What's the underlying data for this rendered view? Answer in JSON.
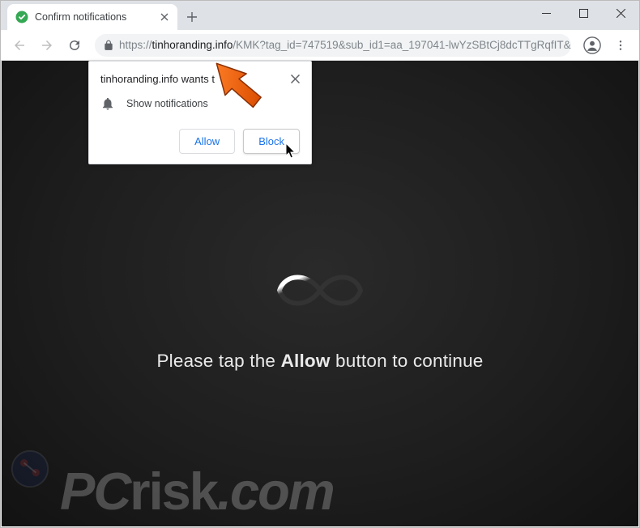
{
  "tab": {
    "title": "Confirm notifications"
  },
  "address": {
    "protocol": "https://",
    "host": "tinhoranding.info",
    "path": "/KMK?tag_id=747519&sub_id1=aa_197041-lwYzSBtCj8dcTTgRqfIT&..."
  },
  "dialog": {
    "title": "tinhoranding.info wants t",
    "body": "Show notifications",
    "allow": "Allow",
    "block": "Block"
  },
  "page": {
    "prefix": "Please tap the ",
    "bold": "Allow",
    "suffix": " button to continue"
  },
  "watermark": {
    "text_pc": "PC",
    "text_risk": "risk",
    "text_com": ".com"
  }
}
